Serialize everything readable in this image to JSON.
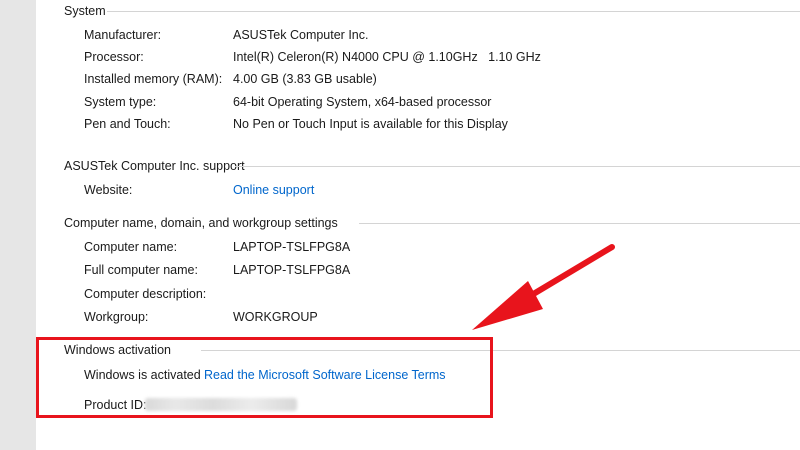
{
  "system": {
    "header": "System",
    "rows": [
      {
        "label": "Manufacturer:",
        "value": "ASUSTek Computer Inc."
      },
      {
        "label": "Processor:",
        "value": "Intel(R) Celeron(R) N4000 CPU @ 1.10GHz   1.10 GHz"
      },
      {
        "label": "Installed memory (RAM):",
        "value": "4.00 GB (3.83 GB usable)"
      },
      {
        "label": "System type:",
        "value": "64-bit Operating System, x64-based processor"
      },
      {
        "label": "Pen and Touch:",
        "value": "No Pen or Touch Input is available for this Display"
      }
    ]
  },
  "support": {
    "header": "ASUSTek Computer Inc. support",
    "website_label": "Website:",
    "website_link": "Online support"
  },
  "computer": {
    "header": "Computer name, domain, and workgroup settings",
    "rows": [
      {
        "label": "Computer name:",
        "value": "LAPTOP-TSLFPG8A"
      },
      {
        "label": "Full computer name:",
        "value": "LAPTOP-TSLFPG8A"
      },
      {
        "label": "Computer description:",
        "value": ""
      },
      {
        "label": "Workgroup:",
        "value": "WORKGROUP"
      }
    ]
  },
  "activation": {
    "header": "Windows activation",
    "status": "Windows is activated",
    "license_link": "Read the Microsoft Software License Terms",
    "product_id_label": "Product ID:"
  },
  "colors": {
    "link": "#0066cc",
    "highlight": "#e8141c",
    "background": "#ffffff"
  }
}
